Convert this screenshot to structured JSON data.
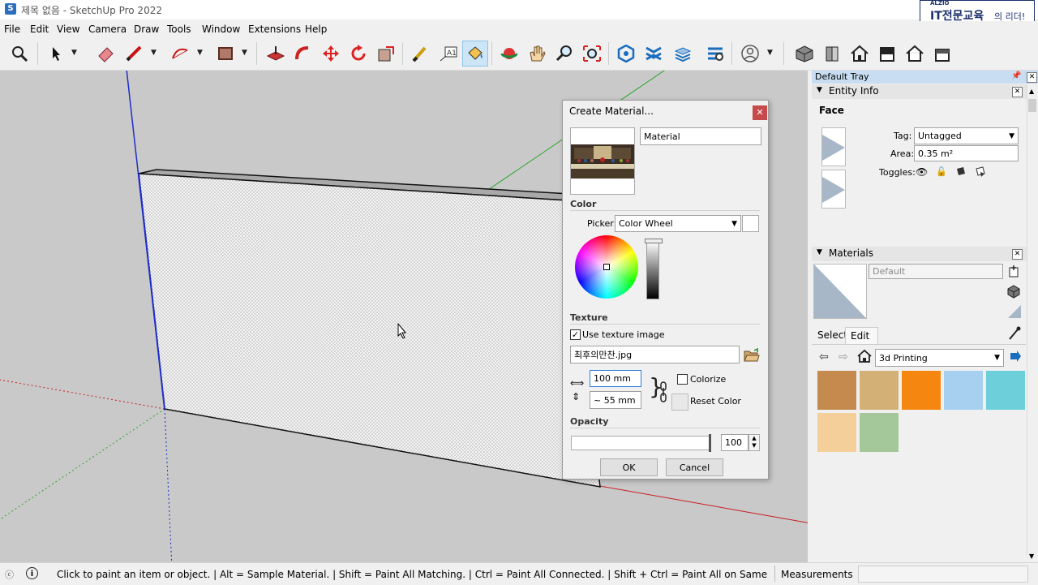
{
  "window": {
    "title": "제목 없음 - SketchUp Pro 2022",
    "app_icon": "sketchup-logo-icon"
  },
  "brand": {
    "small": "ALZIO",
    "main": "IT전문교육",
    "suffix": "의 리더!"
  },
  "menu": [
    "File",
    "Edit",
    "View",
    "Camera",
    "Draw",
    "Tools",
    "Window",
    "Extensions",
    "Help"
  ],
  "toolbar": {
    "icons": [
      "search-icon",
      "select-arrow-icon",
      "eraser-icon",
      "pencil-line-icon",
      "arc-icon",
      "rectangle-icon",
      "push-pull-icon",
      "follow-me-icon",
      "move-icon",
      "rotate-icon",
      "scale-icon",
      "tape-measure-icon",
      "text-icon",
      "paint-bucket-icon",
      "orbit-icon",
      "pan-icon",
      "zoom-icon",
      "zoom-extents-icon",
      "warehouse-icon",
      "extension-icon",
      "layout-icon",
      "settings-icon",
      "account-icon",
      "iso-view-icon",
      "top-view-icon",
      "front-view-icon",
      "right-view-icon",
      "back-view-icon",
      "left-view-icon"
    ],
    "active_tool": "paint-bucket-icon"
  },
  "dialog": {
    "title": "Create Material...",
    "name_value": "Material",
    "color_label": "Color",
    "picker_label": "Picker:",
    "picker_value": "Color Wheel",
    "texture_label": "Texture",
    "use_texture_label": "Use texture image",
    "use_texture_checked": true,
    "texture_file": "최후의만찬.jpg",
    "width_value": "100 mm",
    "height_value": "~ 55 mm",
    "colorize_label": "Colorize",
    "reset_color_label": "Reset Color",
    "opacity_label": "Opacity",
    "opacity_value": "100",
    "ok_label": "OK",
    "cancel_label": "Cancel"
  },
  "tray": {
    "title": "Default Tray",
    "entity_info": {
      "header": "Entity Info",
      "type": "Face",
      "tag_label": "Tag:",
      "tag_value": "Untagged",
      "area_label": "Area:",
      "area_value": "0.35 m²",
      "toggles_label": "Toggles:"
    },
    "materials": {
      "header": "Materials",
      "current_name": "Default",
      "tab_select": "Select",
      "tab_edit": "Edit",
      "library": "3d Printing",
      "swatch_colors": [
        "#c48a4e",
        "#d3b076",
        "#f5860f",
        "#a6cff0",
        "#6dcfd9",
        "#f5cf9a",
        "#a4c89a"
      ]
    }
  },
  "status": {
    "message": "Click to paint an item or object. | Alt = Sample Material. | Shift = Paint All Matching. | Ctrl = Paint All Connected. | Shift + Ctrl = Paint All on Same Ob...",
    "measurements_label": "Measurements"
  }
}
